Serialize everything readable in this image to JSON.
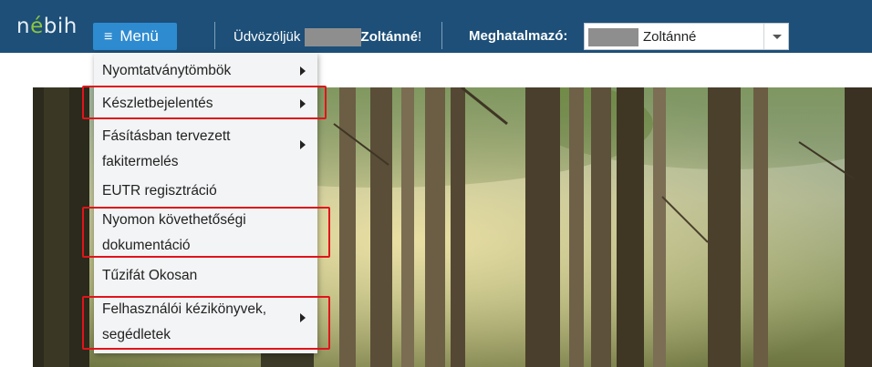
{
  "header": {
    "logo_prefix": "n",
    "logo_dot": "é",
    "logo_suffix": "bih",
    "menu_label": "Menü",
    "greeting": "Üdvözöljük",
    "user_name": "Zoltánné",
    "greeting_end": "!",
    "mandator_label": "Meghatalmazó:",
    "mandator_value": "Zoltánné"
  },
  "menu": {
    "items": [
      {
        "label": "Nyomtatványtömbök",
        "has_submenu": true,
        "highlighted": false
      },
      {
        "label": "Készletbejelentés",
        "has_submenu": true,
        "highlighted": true
      },
      {
        "label_line1": "Fásításban tervezett",
        "label_line2": "fakitermelés",
        "has_submenu": true,
        "highlighted": false
      },
      {
        "label": "EUTR regisztráció",
        "has_submenu": false,
        "highlighted": false
      },
      {
        "label_line1": "Nyomon követhetőségi",
        "label_line2": "dokumentáció",
        "has_submenu": false,
        "highlighted": true
      },
      {
        "label": "Tűzifát Okosan",
        "has_submenu": false,
        "highlighted": false
      },
      {
        "label_line1": "Felhasználói kézikönyvek,",
        "label_line2": "segédletek",
        "has_submenu": true,
        "highlighted": true
      }
    ]
  },
  "colors": {
    "header_bg": "#1d4f78",
    "menu_button": "#2e8bd0",
    "highlight_border": "#e0141b"
  }
}
